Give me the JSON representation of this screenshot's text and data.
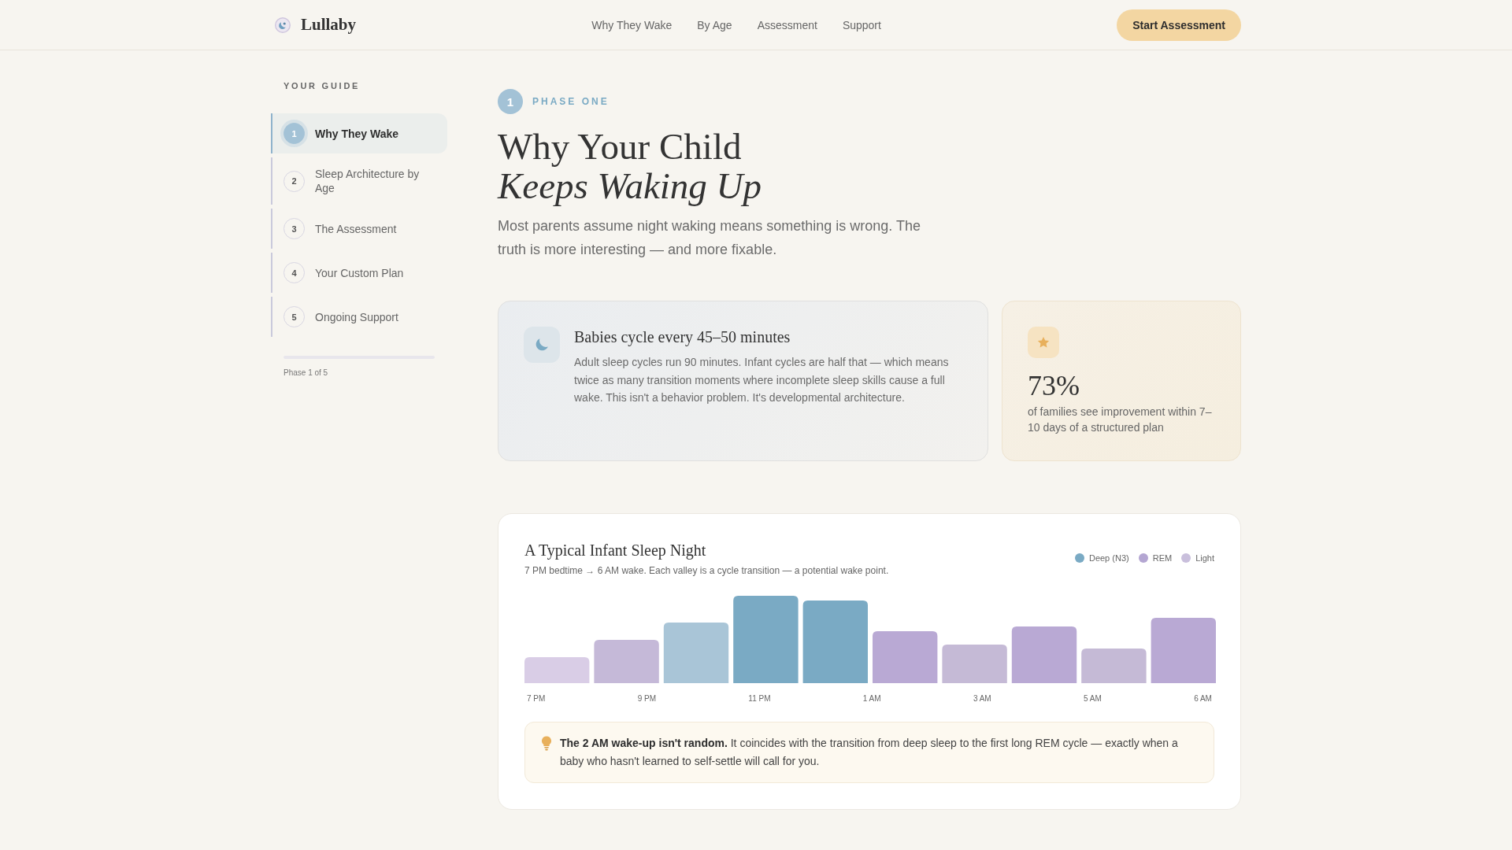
{
  "header": {
    "logo": "Lullaby",
    "nav": [
      {
        "label": "Why They Wake"
      },
      {
        "label": "By Age"
      },
      {
        "label": "Assessment"
      },
      {
        "label": "Support"
      }
    ],
    "cta": "Start Assessment"
  },
  "sidebar": {
    "heading": "YOUR GUIDE",
    "items": [
      {
        "number": "1",
        "label": "Why They Wake",
        "selected": true
      },
      {
        "number": "2",
        "label": "Sleep Architecture by Age",
        "selected": false
      },
      {
        "number": "3",
        "label": "The Assessment",
        "selected": false
      },
      {
        "number": "4",
        "label": "Your Custom Plan",
        "selected": false
      },
      {
        "number": "5",
        "label": "Ongoing Support",
        "selected": false
      }
    ],
    "progress_label": "Phase 1 of 5"
  },
  "hero": {
    "badge": "1",
    "eyebrow": "PHASE ONE",
    "title": "Why Your Child *Keeps Waking Up*",
    "lead": "Most parents assume night waking means something is wrong. The truth is more interesting — and more fixable."
  },
  "fact_card": {
    "title": "Babies cycle every 45–50 minutes",
    "body": "Adult sleep cycles run 90 minutes. Infant cycles are half that — which means twice as many transition moments where incomplete sleep skills cause a full wake. This isn't a behavior problem. It's developmental architecture."
  },
  "stat_card": {
    "value": "73%",
    "caption": "of families see improvement within 7–10 days of a structured plan"
  },
  "sleep_chart": {
    "title": "A Typical Infant Sleep Night",
    "subtitle": "7 PM bedtime → 6 AM wake. Each valley is a cycle transition — a potential wake point.",
    "legend": [
      {
        "label": "Deep (N3)",
        "color": "#7aaac4"
      },
      {
        "label": "REM",
        "color": "#b4a6d2"
      },
      {
        "label": "Light",
        "color": "#c9bfdc"
      }
    ],
    "axis_labels": [
      "7 PM",
      "9 PM",
      "11 PM",
      "1 AM",
      "3 AM",
      "5 AM",
      "6 AM"
    ],
    "note": "**The 2 AM wake-up isn't random.** It coincides with the transition from deep sleep to the first long REM cycle — exactly when a baby who hasn't learned to self-settle will call for you."
  }
}
